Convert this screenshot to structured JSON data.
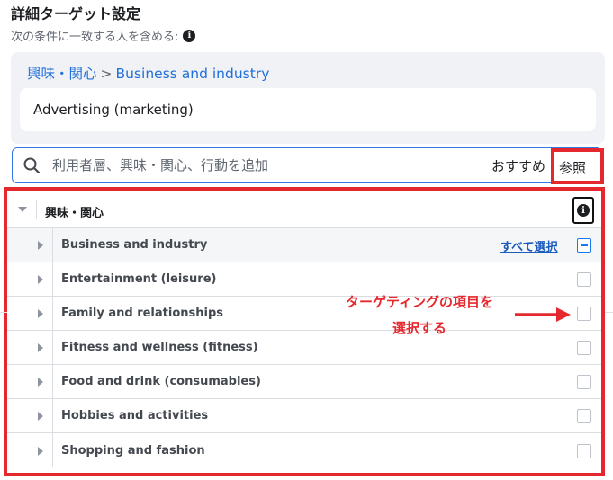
{
  "header": {
    "title": "詳細ターゲット設定",
    "subtitle": "次の条件に一致する人を含める:",
    "info_glyph": "i"
  },
  "selection": {
    "breadcrumb_parent": "興味・関心",
    "breadcrumb_separator": ">",
    "breadcrumb_child": "Business and industry",
    "chip_label": "Advertising (marketing)"
  },
  "search": {
    "placeholder": "利用者層、興味・関心、行動を追加",
    "suggest_label": "おすすめ",
    "browse_label": "参照"
  },
  "tree": {
    "category_label": "興味・関心",
    "info_glyph": "i",
    "select_all_label": "すべて選択",
    "items": [
      {
        "label": "Business and industry",
        "state": "partial"
      },
      {
        "label": "Entertainment (leisure)",
        "state": "unchecked"
      },
      {
        "label": "Family and relationships",
        "state": "unchecked"
      },
      {
        "label": "Fitness and wellness (fitness)",
        "state": "unchecked"
      },
      {
        "label": "Food and drink (consumables)",
        "state": "unchecked"
      },
      {
        "label": "Hobbies and activities",
        "state": "unchecked"
      },
      {
        "label": "Shopping and fashion",
        "state": "unchecked"
      }
    ]
  },
  "annotation": {
    "line1": "ターゲティングの項目を",
    "line2": "選択する"
  },
  "colors": {
    "link": "#216fdb",
    "highlight": "#e5282d",
    "checkbox_active": "#1877f2"
  }
}
